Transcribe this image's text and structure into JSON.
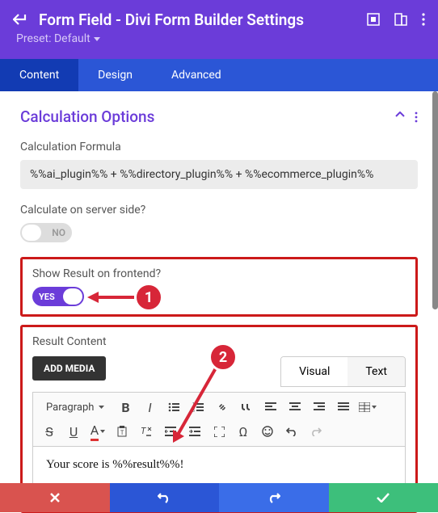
{
  "header": {
    "title": "Form Field - Divi Form Builder Settings",
    "preset_label": "Preset: Default"
  },
  "tabs": {
    "content": "Content",
    "design": "Design",
    "advanced": "Advanced"
  },
  "section": {
    "title": "Calculation Options"
  },
  "fields": {
    "formula_label": "Calculation Formula",
    "formula_value": "%%ai_plugin%% + %%directory_plugin%% + %%ecommerce_plugin%%",
    "server_label": "Calculate on server side?",
    "server_value": "NO",
    "frontend_label": "Show Result on frontend?",
    "frontend_value": "YES",
    "result_label": "Result Content"
  },
  "editor": {
    "add_media": "ADD MEDIA",
    "visual_tab": "Visual",
    "text_tab": "Text",
    "paragraph": "Paragraph",
    "body": "Your score is %%result%%!"
  },
  "callouts": {
    "one": "1",
    "two": "2"
  }
}
